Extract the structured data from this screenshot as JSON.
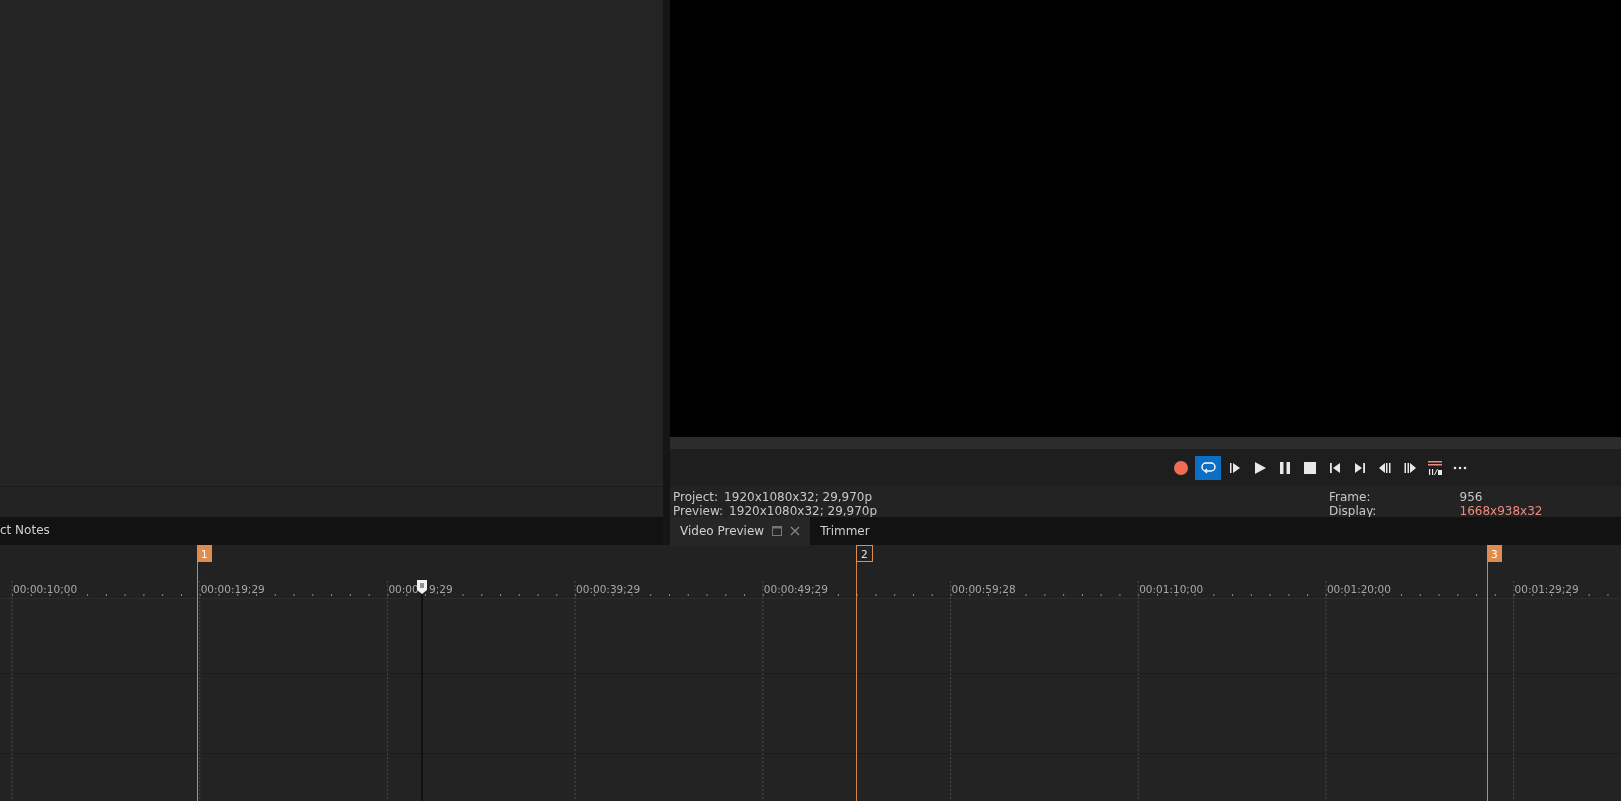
{
  "left_panel": {
    "tabs": [
      {
        "label": "ct Notes"
      }
    ]
  },
  "preview": {
    "transport": [
      {
        "kind": "record"
      },
      {
        "kind": "loop",
        "on": true
      },
      {
        "kind": "play-from-start"
      },
      {
        "kind": "play"
      },
      {
        "kind": "pause"
      },
      {
        "kind": "stop"
      },
      {
        "kind": "go-start"
      },
      {
        "kind": "go-end"
      },
      {
        "kind": "prev-frame"
      },
      {
        "kind": "next-frame"
      },
      {
        "kind": "split-screen"
      },
      {
        "kind": "more"
      }
    ],
    "info_left": [
      {
        "label": "Project:",
        "value": "1920x1080x32; 29,970p"
      },
      {
        "label": "Preview:",
        "value": "1920x1080x32; 29,970p"
      }
    ],
    "info_right": [
      {
        "label": "Frame:",
        "value": "956",
        "highlight": false
      },
      {
        "label": "Display:",
        "value": "1668x938x32",
        "highlight": true
      }
    ],
    "tabs": [
      {
        "label": "Video Preview",
        "selected": true,
        "closable": true
      },
      {
        "label": "Trimmer",
        "selected": false,
        "closable": false
      }
    ]
  },
  "timeline": {
    "markers": [
      {
        "label": "1",
        "selected": false
      },
      {
        "label": "2",
        "selected": true
      },
      {
        "label": "3",
        "selected": false
      }
    ],
    "ruler_labels": [
      {
        "text": "00:00:10;00"
      },
      {
        "text": "00:00:19;29"
      },
      {
        "text": "00:00",
        "tail": "9;29"
      },
      {
        "text": "00:00:39;29"
      },
      {
        "text": "00:00:49;29"
      },
      {
        "text": "00:00:59;28"
      },
      {
        "text": "00:01:10;00"
      },
      {
        "text": "00:01:20;00"
      },
      {
        "text": "00:01:29;29"
      }
    ]
  }
}
